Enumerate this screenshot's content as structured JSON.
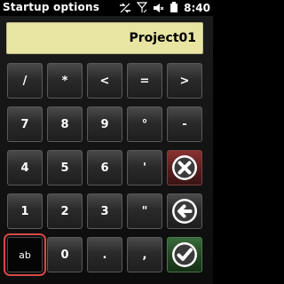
{
  "status_bar": {
    "title": "Startup options",
    "time": "8:40",
    "icons": [
      "connectivity-icon",
      "signal-icon",
      "volume-icon",
      "battery-icon"
    ]
  },
  "display": {
    "value": "Project01"
  },
  "keys": {
    "slash": "/",
    "asterisk": "*",
    "less_than": "<",
    "equals": "=",
    "greater_than": ">",
    "seven": "7",
    "eight": "8",
    "nine": "9",
    "degree": "°",
    "minus": "-",
    "four": "4",
    "five": "5",
    "six": "6",
    "apostrophe": "'",
    "one": "1",
    "two": "2",
    "three": "3",
    "double_quote": "\"",
    "ab": "ab",
    "zero": "0",
    "period": ".",
    "comma": ","
  },
  "action_icons": [
    "close-icon",
    "backspace-arrow-icon",
    "checkmark-icon"
  ],
  "colors": {
    "display_bg": "#e8e4a2",
    "delete_key": "#6a2626",
    "ok_key": "#2a5a2a",
    "selected_outline": "#d64848"
  }
}
